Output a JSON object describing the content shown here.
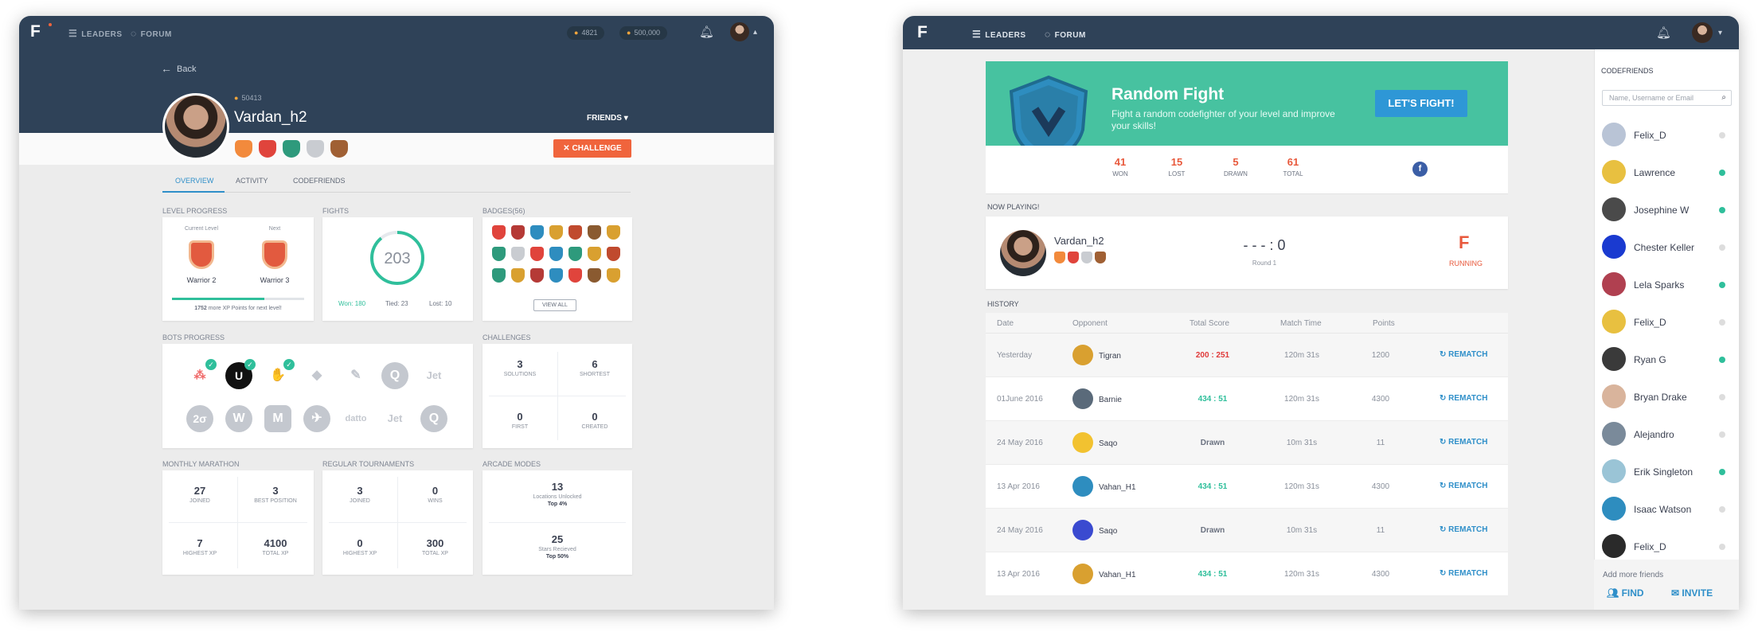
{
  "colors": {
    "nav": "#2f4258",
    "accent": "#2f8fc9",
    "danger": "#f0643c",
    "teal": "#47c2a0",
    "online": "#2fbf9b",
    "offline": "#dddddd"
  },
  "profile": {
    "nav": {
      "leaders": "LEADERS",
      "forum": "FORUM",
      "coins": "4821",
      "xp": "500,000"
    },
    "back": "Back",
    "xp": "50413",
    "username": "Vardan_h2",
    "friends": "FRIENDS",
    "challenge": "CHALLENGE",
    "tabs": [
      "OVERVIEW",
      "ACTIVITY",
      "CODEFRIENDS"
    ],
    "level": {
      "title": "LEVEL PROGRESS",
      "current_label": "Current Level",
      "next_label": "Next",
      "current": "Warrior 2",
      "next": "Warrior 3",
      "progress": 0.7,
      "xp_remaining": "1752",
      "xp_note": "more XP Points for next level!"
    },
    "fights": {
      "title": "FIGHTS",
      "total": "203",
      "won": "Won: 180",
      "tied": "Tied: 23",
      "lost": "Lost: 10",
      "won_fraction": 0.89
    },
    "badges": {
      "title": "BADGES(56)",
      "view_all": "VIEW ALL"
    },
    "bots": {
      "title": "BOTS PROGRESS",
      "row1": [
        "",
        "U",
        "",
        "",
        "",
        "Q",
        "Jet"
      ],
      "row2": [
        "2σ",
        "",
        "M",
        "",
        "datto",
        "Jet",
        "Q"
      ]
    },
    "challenges": {
      "title": "CHALLENGES",
      "items": [
        {
          "n": "3",
          "l": "SOLUTIONS"
        },
        {
          "n": "6",
          "l": "SHORTEST"
        },
        {
          "n": "0",
          "l": "FIRST"
        },
        {
          "n": "0",
          "l": "CREATED"
        }
      ]
    },
    "marathon": {
      "title": "MONTHLY MARATHON",
      "items": [
        {
          "n": "27",
          "l": "JOINED"
        },
        {
          "n": "3",
          "l": "BEST POSITION"
        },
        {
          "n": "7",
          "l": "HIGHEST XP"
        },
        {
          "n": "4100",
          "l": "TOTAL XP"
        }
      ]
    },
    "tournaments": {
      "title": "REGULAR TOURNAMENTS",
      "items": [
        {
          "n": "3",
          "l": "JOINED"
        },
        {
          "n": "0",
          "l": "WINS"
        },
        {
          "n": "0",
          "l": "HIGHEST XP"
        },
        {
          "n": "300",
          "l": "TOTAL XP"
        }
      ]
    },
    "arcade": {
      "title": "ARCADE MODES",
      "a_n": "13",
      "a_l": "Locations Unlocked",
      "a_s": "Top 4%",
      "b_n": "25",
      "b_l": "Stars Recieved",
      "b_s": "Top 50%"
    }
  },
  "fight": {
    "nav": {
      "leaders": "LEADERS",
      "forum": "FORUM"
    },
    "title": "Random Fight",
    "desc": "Fight a random codefighter of your level and improve your skills!",
    "button": "LET'S FIGHT!",
    "counts": [
      {
        "n": "41",
        "l": "WON"
      },
      {
        "n": "15",
        "l": "LOST"
      },
      {
        "n": "5",
        "l": "DRAWN"
      },
      {
        "n": "61",
        "l": "TOTAL"
      }
    ],
    "now_playing": "NOW PLAYING!",
    "player": "Vardan_h2",
    "score": "- - - : 0",
    "round": "Round 1",
    "status": "RUNNING",
    "history": "HISTORY",
    "cols": [
      "Date",
      "Opponent",
      "Total Score",
      "Match Time",
      "Points"
    ],
    "rematch": "REMATCH",
    "rows": [
      {
        "date": "Yesterday",
        "opp": "Tigran",
        "score": "200 : 251",
        "time": "120m 31s",
        "pts": "1200",
        "color": "#e03a3a"
      },
      {
        "date": "01June 2016",
        "opp": "Barnie",
        "score": "434 : 51",
        "time": "120m 31s",
        "pts": "4300",
        "color": "#2fbf9b"
      },
      {
        "date": "24 May 2016",
        "opp": "Saqo",
        "score": "Drawn",
        "time": "10m 31s",
        "pts": "11",
        "color": "#6b7280"
      },
      {
        "date": "13 Apr 2016",
        "opp": "Vahan_H1",
        "score": "434 : 51",
        "time": "120m 31s",
        "pts": "4300",
        "color": "#2fbf9b"
      },
      {
        "date": "24 May 2016",
        "opp": "Saqo",
        "score": "Drawn",
        "time": "10m 31s",
        "pts": "11",
        "color": "#6b7280"
      },
      {
        "date": "13 Apr 2016",
        "opp": "Vahan_H1",
        "score": "434 : 51",
        "time": "120m 31s",
        "pts": "4300",
        "color": "#2fbf9b"
      }
    ],
    "sidebar": {
      "title": "CODEFRIENDS",
      "search_placeholder": "Name, Username or Email",
      "friends": [
        {
          "name": "Felix_D",
          "online": false
        },
        {
          "name": "Lawrence",
          "online": true
        },
        {
          "name": "Josephine W",
          "online": true
        },
        {
          "name": "Chester Keller",
          "online": false
        },
        {
          "name": "Lela Sparks",
          "online": true
        },
        {
          "name": "Felix_D",
          "online": false
        },
        {
          "name": "Ryan G",
          "online": true
        },
        {
          "name": "Bryan Drake",
          "online": false
        },
        {
          "name": "Alejandro",
          "online": false
        },
        {
          "name": "Erik Singleton",
          "online": true
        },
        {
          "name": "Isaac Watson",
          "online": false
        },
        {
          "name": "Felix_D",
          "online": false
        }
      ],
      "add_more": "Add more friends",
      "find": "FIND",
      "invite": "INVITE"
    }
  }
}
